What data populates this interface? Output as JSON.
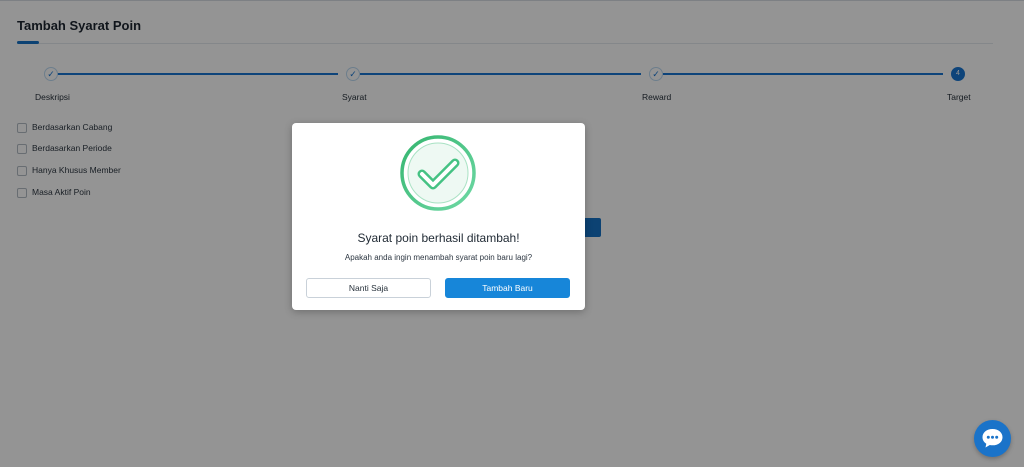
{
  "page": {
    "title": "Tambah Syarat Poin"
  },
  "stepper": {
    "steps": [
      {
        "label": "Deskripsi",
        "status": "done",
        "icon": "check-icon"
      },
      {
        "label": "Syarat",
        "status": "done",
        "icon": "check-icon"
      },
      {
        "label": "Reward",
        "status": "done",
        "icon": "check-icon"
      },
      {
        "label": "Target",
        "status": "active",
        "number": "4"
      }
    ]
  },
  "conditions": {
    "options": [
      {
        "label": "Berdasarkan Cabang",
        "checked": false
      },
      {
        "label": "Berdasarkan Periode",
        "checked": false
      },
      {
        "label": "Hanya Khusus Member",
        "checked": false
      },
      {
        "label": "Masa Aktif Poin",
        "checked": false
      }
    ]
  },
  "modal": {
    "icon": "success-check-icon",
    "title": "Syarat poin berhasil ditambah!",
    "message": "Apakah anda ingin menambah syarat poin baru lagi?",
    "cancel_label": "Nanti Saja",
    "confirm_label": "Tambah Baru"
  },
  "chat": {
    "icon": "chat-bubble-icon"
  },
  "colors": {
    "primary": "#1786d9",
    "success": "#3dbf7e",
    "overlay": "rgba(0,0,0,0.42)"
  }
}
